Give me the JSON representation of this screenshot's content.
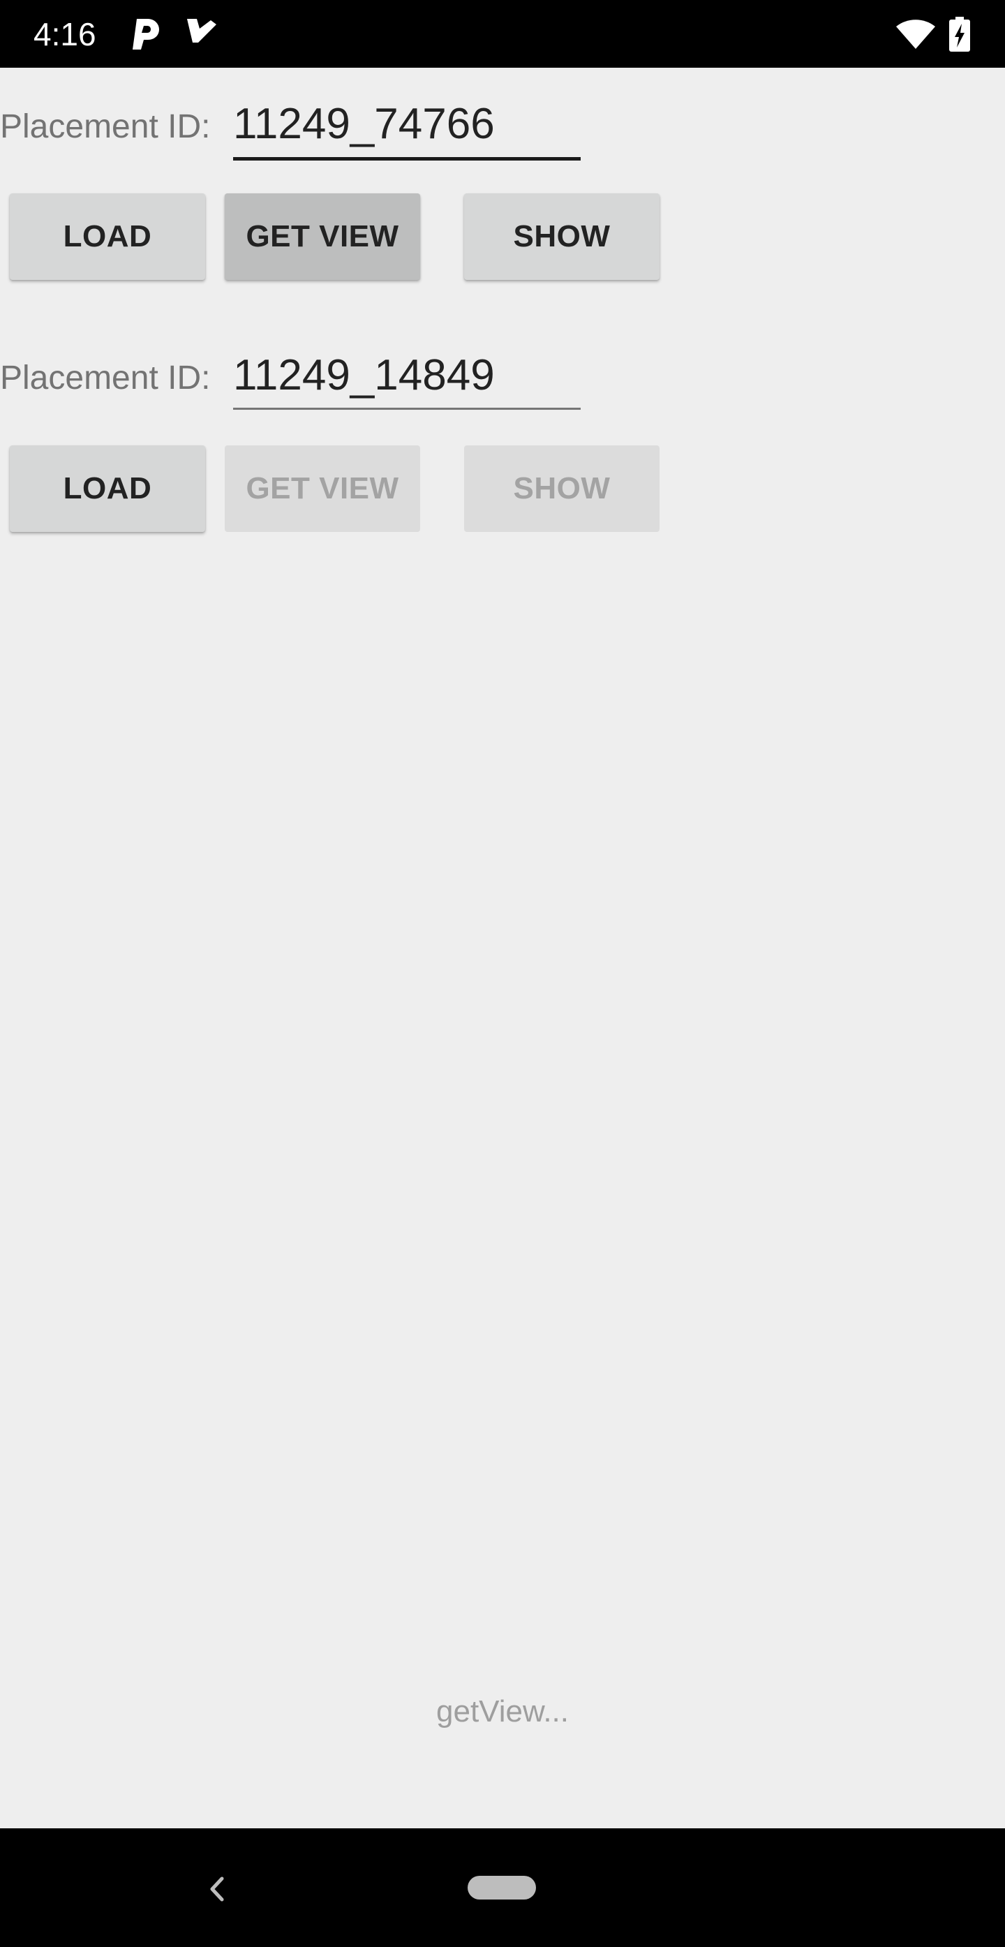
{
  "status_bar": {
    "time": "4:16",
    "icons": [
      "p-app-icon",
      "checkmark-app-icon",
      "wifi-icon",
      "battery-charging-icon"
    ]
  },
  "placements": [
    {
      "label": "Placement ID:",
      "value": "11249_74766",
      "field_focused": true,
      "buttons": {
        "load": {
          "label": "LOAD",
          "state": "enabled"
        },
        "get_view": {
          "label": "GET VIEW",
          "state": "pressed"
        },
        "show": {
          "label": "SHOW",
          "state": "enabled"
        }
      }
    },
    {
      "label": "Placement ID:",
      "value": "11249_14849",
      "field_focused": false,
      "buttons": {
        "load": {
          "label": "LOAD",
          "state": "enabled"
        },
        "get_view": {
          "label": "GET VIEW",
          "state": "disabled"
        },
        "show": {
          "label": "SHOW",
          "state": "disabled"
        }
      }
    }
  ],
  "status_message": "getView...",
  "colors": {
    "background": "#eeeeee",
    "system_bars": "#000000",
    "label_text": "#737373",
    "button_enabled": "#d6d7d7",
    "button_pressed": "#bdbebe",
    "button_disabled_text": "#a3a3a3"
  }
}
